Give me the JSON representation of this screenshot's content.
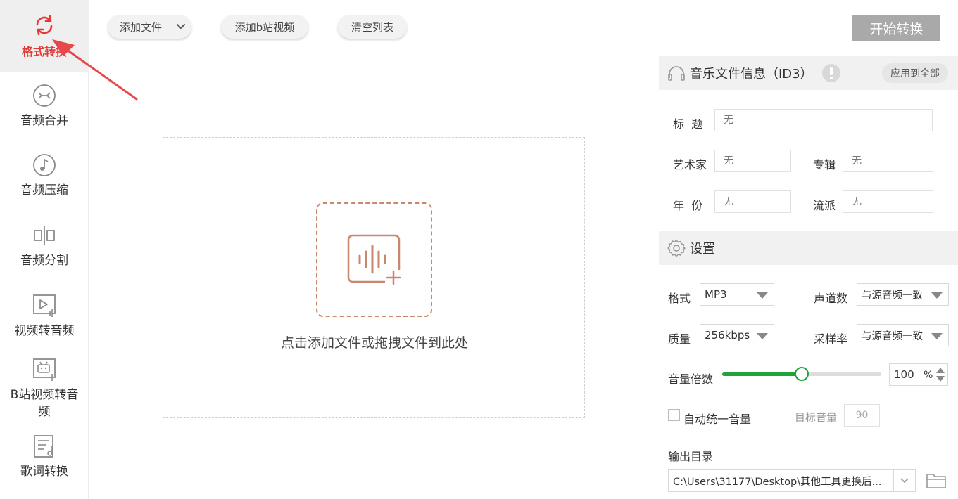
{
  "sidebar": {
    "items": [
      {
        "label": "格式转换",
        "icon": "refresh-icon",
        "active": true
      },
      {
        "label": "音频合并",
        "icon": "merge-icon"
      },
      {
        "label": "音频压缩",
        "icon": "music-note-icon"
      },
      {
        "label": "音频分割",
        "icon": "split-icon"
      },
      {
        "label": "视频转音频",
        "icon": "video-to-audio-icon"
      },
      {
        "label": "B站视频转音频",
        "icon": "bilibili-icon"
      },
      {
        "label": "歌词转换",
        "icon": "lyrics-icon"
      }
    ]
  },
  "toolbar": {
    "add_file_label": "添加文件",
    "add_bili_label": "添加b站视频",
    "clear_label": "清空列表",
    "start_label": "开始转换"
  },
  "dropzone": {
    "hint": "点击添加文件或拖拽文件到此处"
  },
  "id3": {
    "title": "音乐文件信息（ID3）",
    "apply_all": "应用到全部",
    "fields": {
      "title_label": "标  题",
      "title_placeholder": "无",
      "artist_label": "艺术家",
      "artist_placeholder": "无",
      "album_label": "专辑",
      "album_placeholder": "无",
      "year_label": "年  份",
      "year_placeholder": "无",
      "genre_label": "流派",
      "genre_placeholder": "无"
    }
  },
  "settings": {
    "title": "设置",
    "format_label": "格式",
    "format_value": "MP3",
    "channels_label": "声道数",
    "channels_value": "与源音频一致",
    "quality_label": "质量",
    "quality_value": "256kbps",
    "samplerate_label": "采样率",
    "samplerate_value": "与源音频一致",
    "volume_label": "音量倍数",
    "volume_value": "100",
    "volume_unit": "%",
    "volume_fraction": 0.5,
    "auto_volume_label": "自动统一音量",
    "auto_volume_checked": false,
    "target_volume_label": "目标音量",
    "target_volume_value": "90",
    "output_label": "输出目录",
    "output_path": "C:\\Users\\31177\\Desktop\\其他工具更换后..."
  },
  "colors": {
    "active_red": "#e53935",
    "accent_green": "#1fa33a",
    "drop_border": "#c9876f",
    "start_button": "#a9a9a9"
  }
}
